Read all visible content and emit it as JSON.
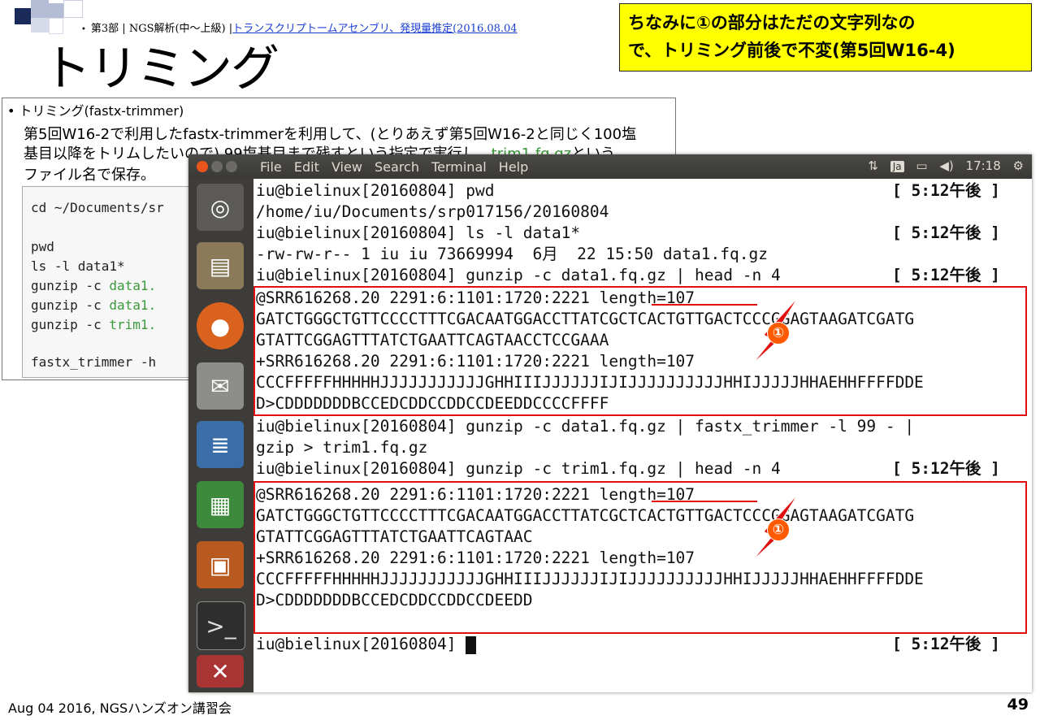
{
  "slide": {
    "breadcrumb_part": "第3部 | NGS解析(中～上級) |",
    "breadcrumb_link": "トランスクリプトームアセンブリ、発現量推定(2016.08.04",
    "title": "トリミング",
    "note_line1": "ちなみに①の部分はただの文字列なの",
    "note_line2": "で、トリミング前後で不変(第5回W16-4)",
    "footer_left": "Aug 04 2016, NGSハンズオン講習会",
    "page_number": "49"
  },
  "doc": {
    "line1": "• トリミング(fastx-trimmer)",
    "line2": "第5回W16-2で利用したfastx-trimmerを利用して、(とりあえず第5回W16-2と同じく100塩",
    "line3a": "基目以降をトリムしたいので) 99塩基目まで残すという指定で実行し、",
    "line3b": "trim1.fq.gz",
    "line3c": "という",
    "line4": "ファイル名で保存。",
    "code1": "cd ~/Documents/sr",
    "code2": "pwd",
    "code3": "ls -l data1*",
    "code4a": "gunzip -c ",
    "code4b": "data1.",
    "code5a": "gunzip -c ",
    "code5b": "data1.",
    "code6a": "gunzip -c ",
    "code6b": "trim1.",
    "code7": "fastx_trimmer -h"
  },
  "terminal": {
    "menu": [
      "File",
      "Edit",
      "View",
      "Search",
      "Terminal",
      "Help"
    ],
    "tray_input": "Ja",
    "tray_clock": "17:18",
    "lines": [
      "iu@bielinux[20160804] pwd",
      "/home/iu/Documents/srp017156/20160804",
      "iu@bielinux[20160804] ls -l data1*",
      "-rw-rw-r-- 1 iu iu 73669994  6月  22 15:50 data1.fq.gz",
      "iu@bielinux[20160804] gunzip -c data1.fq.gz | head -n 4",
      "@SRR616268.20 2291:6:1101:1720:2221 length=107",
      "GATCTGGGCTGTTCCCCTTTCGACAATGGACCTTATCGCTCACTGTTGACTCCCGGAGTAAGATCGATG",
      "GTATTCGGAGTTTATCTGAATTCAGTAACCTCCGAAA",
      "+SRR616268.20 2291:6:1101:1720:2221 length=107",
      "CCCFFFFFHHHHHJJJJJJJJJJJGHHIIIJJJJJJIJIJJJJJJJJJJHHIJJJJJHHAEHHFFFFDDE",
      "D>CDDDDDDDBCCEDCDDCCDDCCDEEDDCCCCFFFF",
      "iu@bielinux[20160804] gunzip -c data1.fq.gz | fastx_trimmer -l 99 - |",
      "gzip > trim1.fq.gz",
      "iu@bielinux[20160804] gunzip -c trim1.fq.gz | head -n 4",
      "@SRR616268.20 2291:6:1101:1720:2221 length=107",
      "GATCTGGGCTGTTCCCCTTTCGACAATGGACCTTATCGCTCACTGTTGACTCCCGGAGTAAGATCGATG",
      "GTATTCGGAGTTTATCTGAATTCAGTAAC",
      "+SRR616268.20 2291:6:1101:1720:2221 length=107",
      "CCCFFFFFHHHHHJJJJJJJJJJJGHHIIIJJJJJJIJIJJJJJJJJJJHHIJJJJJHHAEHHFFFFDDE",
      "D>CDDDDDDDBCCEDCDDCCDDCCDEEDD",
      "iu@bielinux[20160804] "
    ],
    "time_label": "[ 5:12午後 ]",
    "marker": "①"
  }
}
